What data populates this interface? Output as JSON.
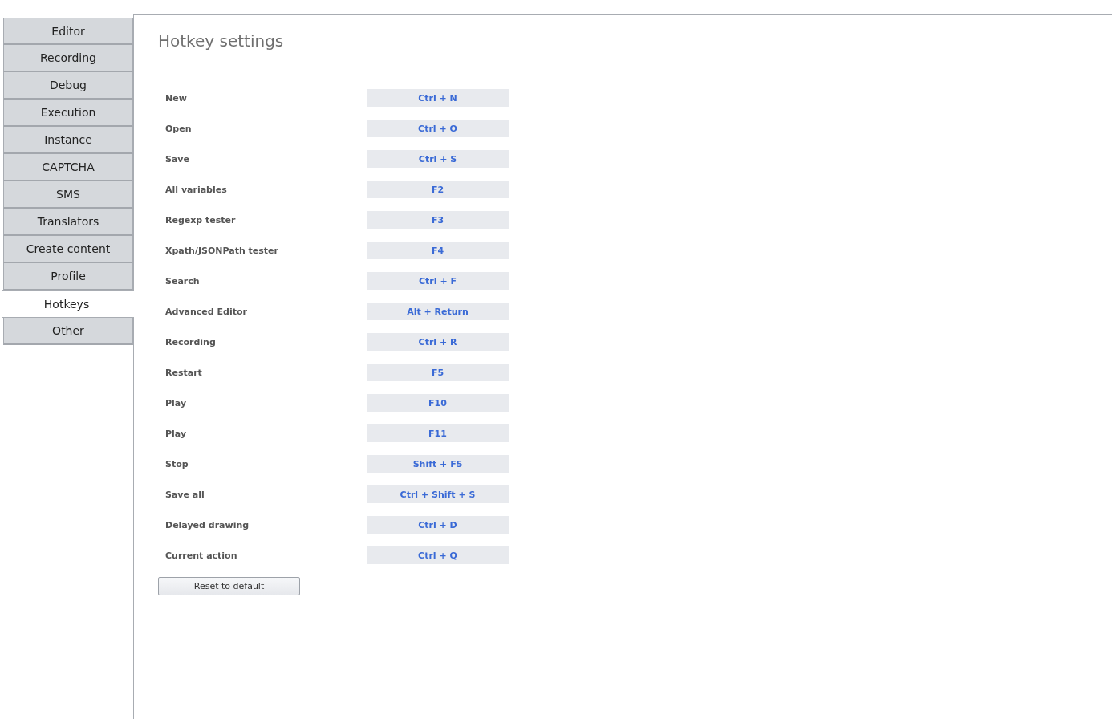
{
  "sidebar": {
    "items": [
      {
        "label": "Editor",
        "selected": false
      },
      {
        "label": "Recording",
        "selected": false
      },
      {
        "label": "Debug",
        "selected": false
      },
      {
        "label": "Execution",
        "selected": false
      },
      {
        "label": "Instance",
        "selected": false
      },
      {
        "label": "CAPTCHA",
        "selected": false
      },
      {
        "label": "SMS",
        "selected": false
      },
      {
        "label": "Translators",
        "selected": false
      },
      {
        "label": "Create content",
        "selected": false
      },
      {
        "label": "Profile",
        "selected": false
      },
      {
        "label": "Hotkeys",
        "selected": true
      },
      {
        "label": "Other",
        "selected": false
      }
    ]
  },
  "panel": {
    "title": "Hotkey settings",
    "hotkeys": [
      {
        "action": "New",
        "keys": "Ctrl + N"
      },
      {
        "action": "Open",
        "keys": "Ctrl + O"
      },
      {
        "action": "Save",
        "keys": "Ctrl + S"
      },
      {
        "action": "All variables",
        "keys": "F2"
      },
      {
        "action": "Regexp tester",
        "keys": "F3"
      },
      {
        "action": "Xpath/JSONPath tester",
        "keys": "F4"
      },
      {
        "action": "Search",
        "keys": "Ctrl + F"
      },
      {
        "action": "Advanced Editor",
        "keys": "Alt + Return"
      },
      {
        "action": "Recording",
        "keys": "Ctrl + R"
      },
      {
        "action": "Restart",
        "keys": "F5"
      },
      {
        "action": "Play",
        "keys": "F10"
      },
      {
        "action": "Play",
        "keys": "F11"
      },
      {
        "action": "Stop",
        "keys": "Shift + F5"
      },
      {
        "action": "Save all",
        "keys": "Ctrl + Shift + S"
      },
      {
        "action": "Delayed drawing",
        "keys": "Ctrl + D"
      },
      {
        "action": "Current action",
        "keys": "Ctrl + Q"
      }
    ],
    "reset_button": "Reset to default"
  }
}
